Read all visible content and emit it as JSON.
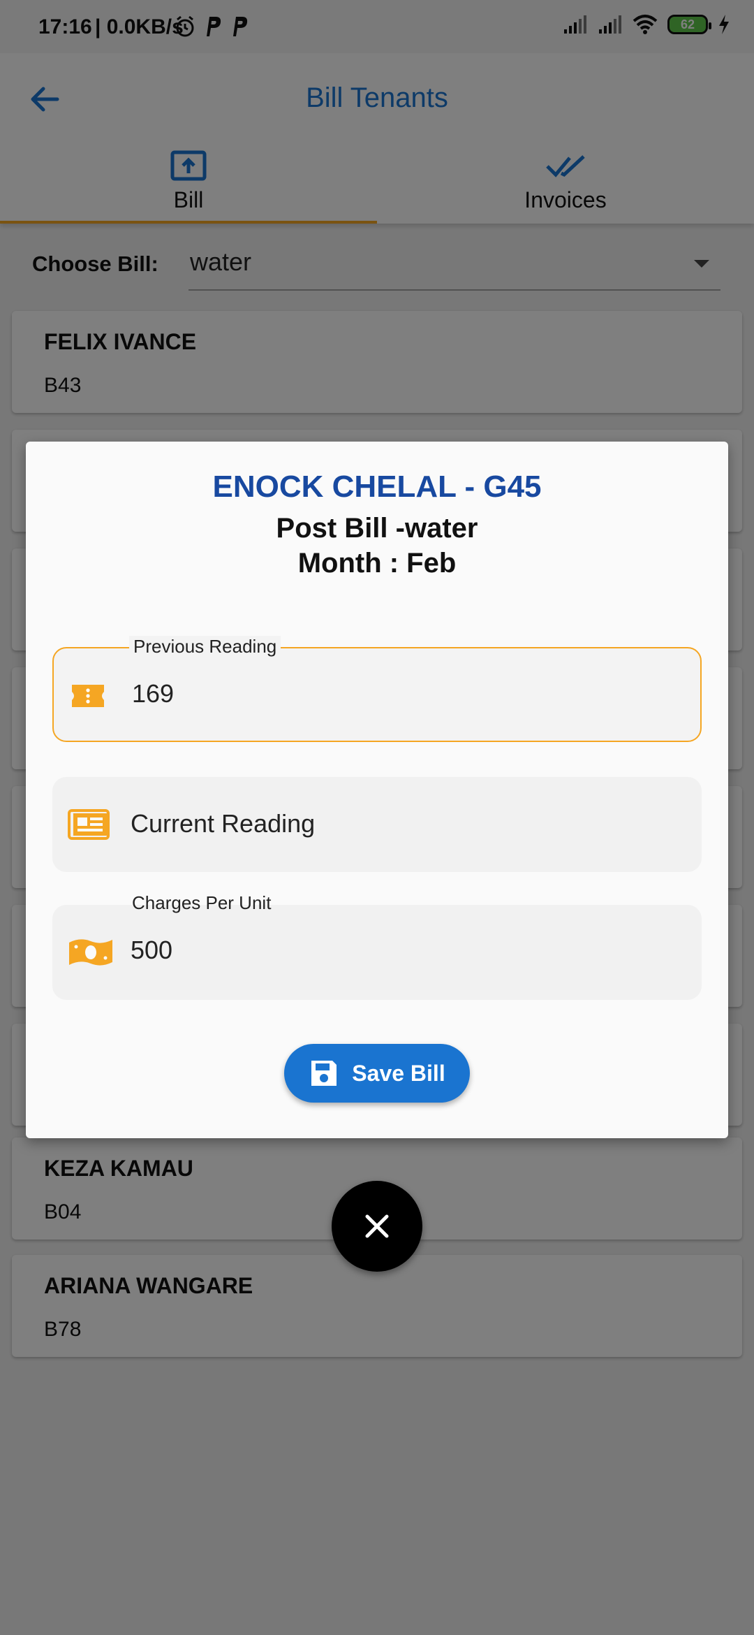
{
  "status_bar": {
    "time": "17:16",
    "net_speed": "| 0.0KB/s",
    "battery": "62"
  },
  "app_bar": {
    "title": "Bill Tenants"
  },
  "tabs": [
    {
      "label": "Bill",
      "icon": "upload-box-icon",
      "active": true
    },
    {
      "label": "Invoices",
      "icon": "double-check-icon",
      "active": false
    }
  ],
  "choose_bill": {
    "label": "Choose Bill:",
    "value": "water"
  },
  "tenants": [
    {
      "name": "FELIX IVANCE",
      "unit": "B43"
    },
    {
      "name": "KEZA KAMAU",
      "unit": "B04"
    },
    {
      "name": "ARIANA WANGARE",
      "unit": "B78"
    }
  ],
  "dialog": {
    "title": "ENOCK CHELAL - G45",
    "subtitle": "Post Bill -water",
    "month": "Month : Feb",
    "fields": {
      "previous": {
        "label": "Previous Reading",
        "value": "169",
        "icon": "ticket-icon"
      },
      "current": {
        "placeholder": "Current Reading",
        "icon": "newspaper-icon"
      },
      "charges": {
        "label": "Charges Per Unit",
        "value": "500",
        "icon": "money-icon"
      }
    },
    "save_label": "Save Bill"
  },
  "colors": {
    "primary": "#1a74d0",
    "accent": "#f5a623",
    "title_blue": "#1849a0"
  }
}
